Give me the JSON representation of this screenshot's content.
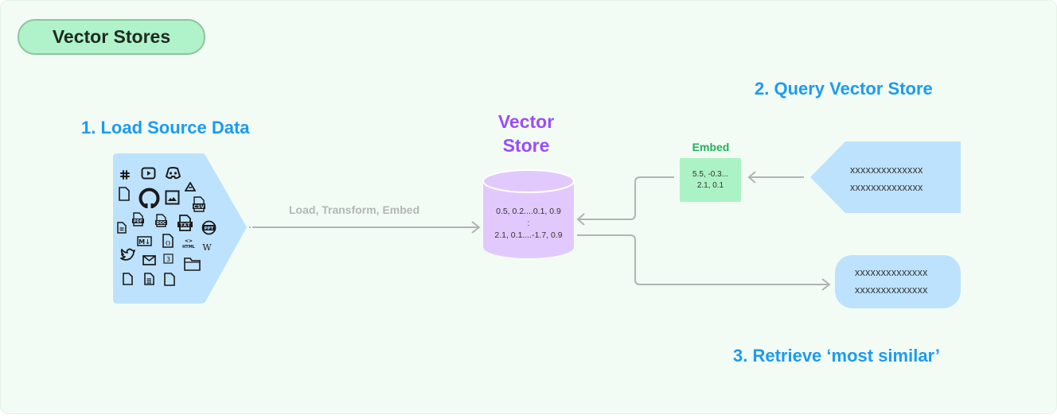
{
  "title": "Vector Stores",
  "steps": {
    "load": "1. Load Source Data",
    "query": "2. Query Vector Store",
    "retrieve": "3. Retrieve ‘most similar’"
  },
  "vector_store": {
    "title_line1": "Vector",
    "title_line2": "Store",
    "row1": "0.5, 0.2....0.1, 0.9",
    "separator": ":",
    "row2": "2.1, 0.1....-1.7, 0.9"
  },
  "pipeline_label": "Load, Transform, Embed",
  "embed": {
    "title": "Embed",
    "line1": "5.5, -0.3...",
    "line2": "2.1, 0.1"
  },
  "query_box": {
    "line1": "xxxxxxxxxxxxxx",
    "line2": "xxxxxxxxxxxxxx"
  },
  "result_box": {
    "line1": "xxxxxxxxxxxxxx",
    "line2": "xxxxxxxxxxxxxx"
  },
  "source_icons": [
    "slack-icon",
    "youtube-icon",
    "discord-icon",
    "file-icon",
    "github-icon",
    "image-icon",
    "google-drive-icon",
    "csv-file-icon",
    "text-file-icon",
    "pdf-file-icon",
    "doc-file-icon",
    "txt-file-icon",
    "ppt-file-icon",
    "markdown-icon",
    "json-file-icon",
    "html-icon",
    "wikipedia-icon",
    "twitter-icon",
    "email-icon",
    "css-icon",
    "folder-icon",
    "file-icon",
    "text-file-icon",
    "file-icon"
  ],
  "colors": {
    "background": "#f2fcf5",
    "heading_blue": "#1c9bf0",
    "vector_purple": "#9b4dfa",
    "cylinder_fill": "#e2c9fd",
    "embed_green": "#22b05a",
    "embed_fill": "#abf3c5",
    "source_fill": "#bde2fd",
    "arrow_gray": "#b3b3b3"
  }
}
